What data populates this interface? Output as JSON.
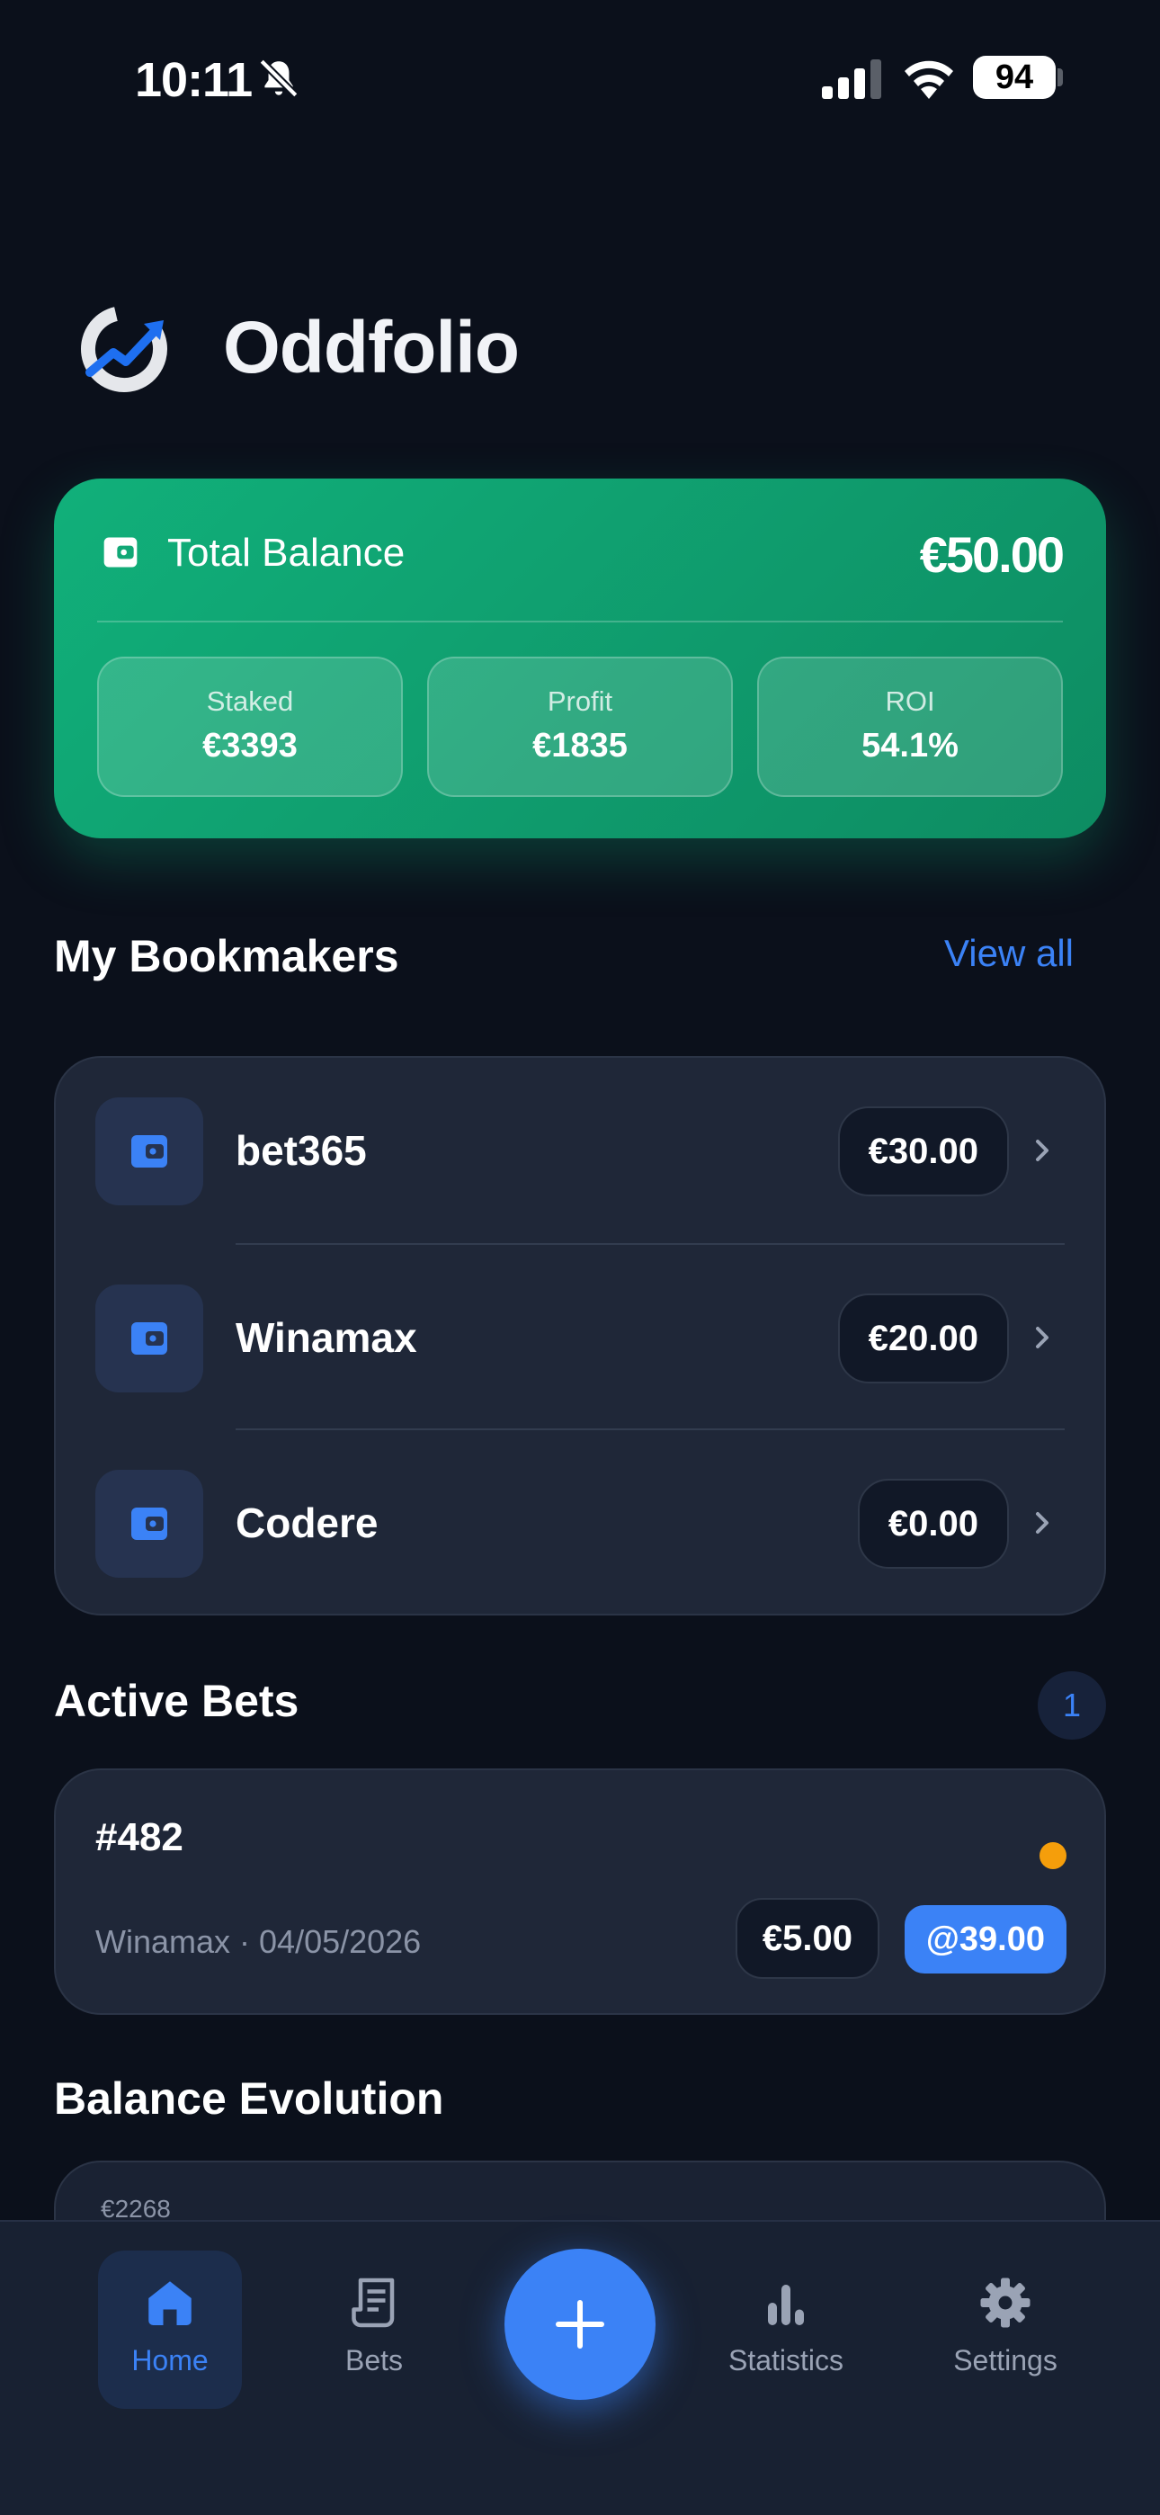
{
  "status_bar": {
    "time": "10:11",
    "battery": "94"
  },
  "brand": {
    "name": "Oddfolio"
  },
  "balance": {
    "label": "Total Balance",
    "amount": "€50.00",
    "stats": [
      {
        "label": "Staked",
        "value": "€3393"
      },
      {
        "label": "Profit",
        "value": "€1835"
      },
      {
        "label": "ROI",
        "value": "54.1%"
      }
    ]
  },
  "bookmakers": {
    "title": "My Bookmakers",
    "view_all": "View all",
    "items": [
      {
        "name": "bet365",
        "amount": "€30.00"
      },
      {
        "name": "Winamax",
        "amount": "€20.00"
      },
      {
        "name": "Codere",
        "amount": "€0.00"
      }
    ]
  },
  "active_bets": {
    "title": "Active Bets",
    "count": "1",
    "items": [
      {
        "id": "#482",
        "meta": "Winamax · 04/05/2026",
        "stake": "€5.00",
        "odds": "@39.00",
        "status_color": "#f59e0b"
      }
    ]
  },
  "balance_evolution": {
    "title": "Balance Evolution",
    "first_label": "€2268"
  },
  "nav": {
    "items": [
      {
        "label": "Home",
        "icon": "home-icon",
        "active": true
      },
      {
        "label": "Bets",
        "icon": "receipt-icon",
        "active": false
      },
      {
        "label": "Statistics",
        "icon": "bar-chart-icon",
        "active": false
      },
      {
        "label": "Settings",
        "icon": "gear-icon",
        "active": false
      }
    ],
    "fab_icon": "plus-icon"
  },
  "colors": {
    "accent": "#3b82f6",
    "balance_green": "#11b07a",
    "pending": "#f59e0b",
    "background": "#0b101b"
  }
}
